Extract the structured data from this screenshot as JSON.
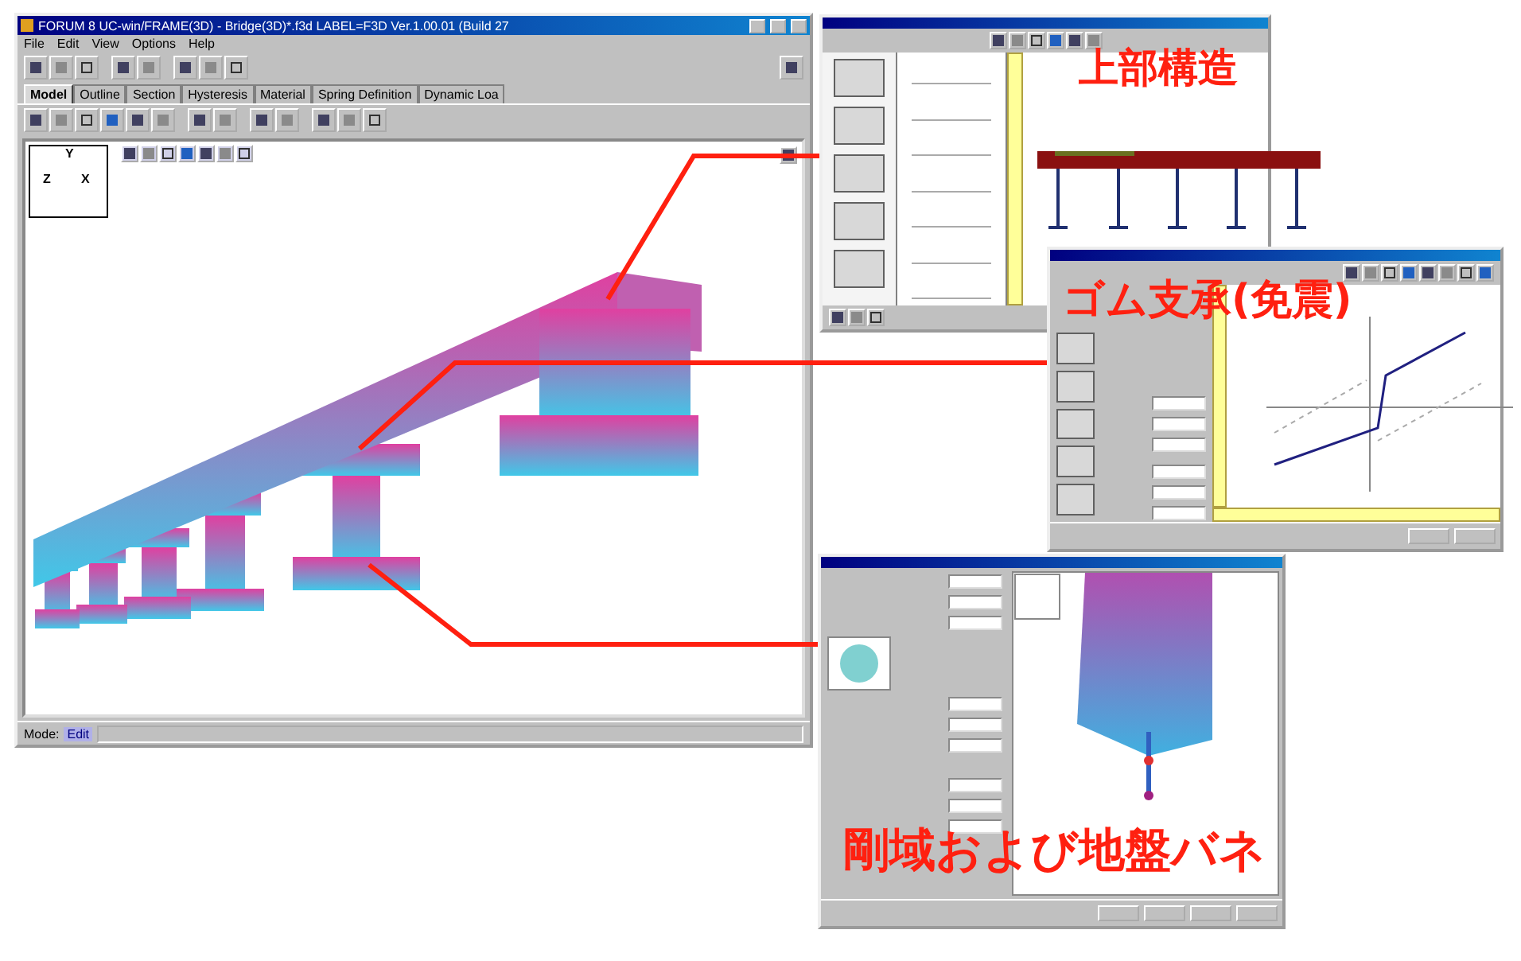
{
  "main_window": {
    "title": "FORUM 8  UC-win/FRAME(3D) - Bridge(3D)*.f3d   LABEL=F3D Ver.1.00.01 (Build 27",
    "menu": [
      "File",
      "Edit",
      "View",
      "Options",
      "Help"
    ],
    "tabs": [
      {
        "label": "Model",
        "selected": true
      },
      {
        "label": "Outline",
        "selected": false
      },
      {
        "label": "Section",
        "selected": false
      },
      {
        "label": "Hysteresis",
        "selected": false
      },
      {
        "label": "Material",
        "selected": false
      },
      {
        "label": "Spring Definition",
        "selected": false
      },
      {
        "label": "Dynamic Loa",
        "selected": false
      }
    ],
    "axis_labels": [
      "Y",
      "Z",
      "X"
    ],
    "status_bar": {
      "label": "Mode:",
      "value": "Edit"
    }
  },
  "callouts": [
    {
      "label": "上部構造"
    },
    {
      "label": "ゴム支承(免震)"
    },
    {
      "label": "剛域および地盤バネ"
    }
  ]
}
